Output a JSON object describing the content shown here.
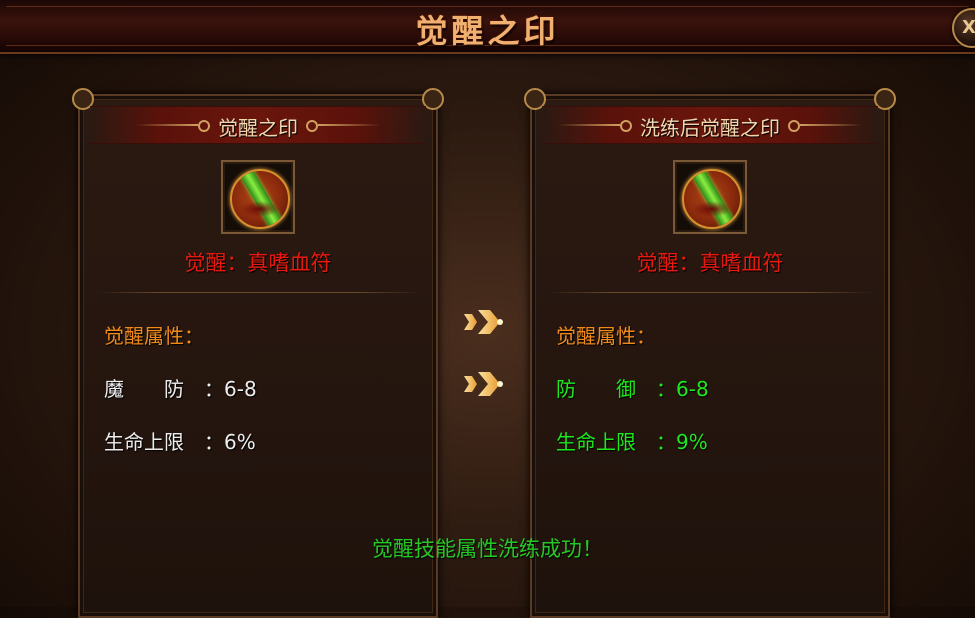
{
  "window": {
    "title": "觉醒之印",
    "close_label": "X"
  },
  "left_panel": {
    "title": "觉醒之印",
    "awaken_name": "觉醒：真嗜血符",
    "attr_heading": "觉醒属性：",
    "stats": [
      {
        "key": "魔　　防",
        "value": "：6-8"
      },
      {
        "key": "生命上限",
        "value": "：6%"
      }
    ],
    "stat_color": "#eeeeee"
  },
  "right_panel": {
    "title": "洗练后觉醒之印",
    "awaken_name": "觉醒：真嗜血符",
    "attr_heading": "觉醒属性：",
    "stats": [
      {
        "key": "防　　御",
        "value": "：6-8"
      },
      {
        "key": "生命上限",
        "value": "：9%"
      }
    ],
    "stat_color": "#1ee81e"
  },
  "arrows": [
    "arrow-right-icon",
    "arrow-right-icon"
  ],
  "message": "觉醒技能属性洗练成功！",
  "colors": {
    "title": "#f0b070",
    "awaken_name": "#e81a10",
    "attr_heading": "#f08a1a",
    "success": "#26c826"
  }
}
